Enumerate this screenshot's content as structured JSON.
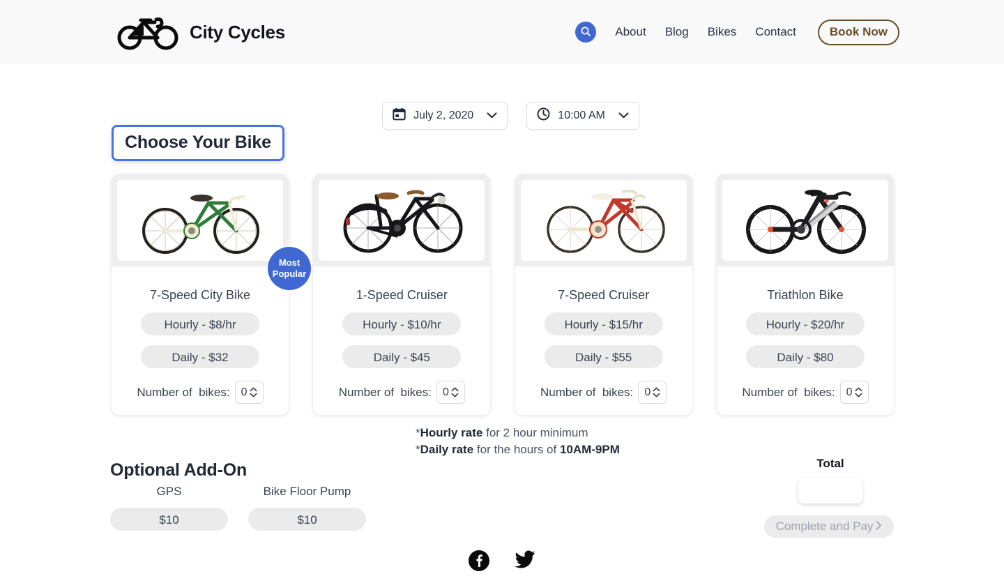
{
  "header": {
    "brand_name": "City Cycles",
    "logo_icon": "bicycle-icon",
    "search_icon": "search-icon",
    "nav": [
      {
        "label": "About"
      },
      {
        "label": "Blog"
      },
      {
        "label": "Bikes"
      },
      {
        "label": "Contact"
      }
    ],
    "book_now_label": "Book Now",
    "book_now_color": "#6b4f24",
    "accent_color": "#3f68d2"
  },
  "pickers": {
    "date": {
      "icon": "calendar-icon",
      "value": "July 2, 2020",
      "chevron": "chevron-down-icon"
    },
    "time": {
      "icon": "clock-icon",
      "value": "10:00 AM",
      "chevron": "chevron-down-icon"
    }
  },
  "choose": {
    "title": "Choose Your Bike",
    "focus_color": "#4a72e8"
  },
  "bikes": [
    {
      "name": "7-Speed City Bike",
      "hourly": "Hourly - $8/hr",
      "daily": "Daily - $32",
      "qty_label": "Number of  bikes:",
      "qty_value": "0",
      "badge_line1": "Most",
      "badge_line2": "Popular",
      "image_icon": "green-city-bike-image"
    },
    {
      "name": "1-Speed Cruiser",
      "hourly": "Hourly - $10/hr",
      "daily": "Daily - $45",
      "qty_label": "Number of  bikes:",
      "qty_value": "0",
      "image_icon": "black-cruiser-bike-image"
    },
    {
      "name": "7-Speed Cruiser",
      "hourly": "Hourly - $15/hr",
      "daily": "Daily - $55",
      "qty_label": "Number of  bikes:",
      "qty_value": "0",
      "image_icon": "red-cruiser-bike-image"
    },
    {
      "name": "Triathlon Bike",
      "hourly": "Hourly - $20/hr",
      "daily": "Daily - $80",
      "qty_label": "Number of  bikes:",
      "qty_value": "0",
      "image_icon": "black-triathlon-bike-image"
    }
  ],
  "notes": {
    "line1_prefix": "*",
    "line1_bold": "Hourly rate",
    "line1_rest": " for 2 hour minimum",
    "line2_prefix": "*",
    "line2_bold": "Daily rate",
    "line2_mid": " for the hours of ",
    "line2_bold2": "10AM-9PM"
  },
  "addons": {
    "title": "Optional Add-On",
    "items": [
      {
        "name": "GPS",
        "price": "$10"
      },
      {
        "name": "Bike Floor Pump",
        "price": "$10"
      }
    ]
  },
  "total": {
    "label": "Total",
    "value": "",
    "pay_label": "Complete and Pay",
    "pay_chevron": "chevron-right-icon"
  },
  "social": [
    {
      "icon": "facebook-icon"
    },
    {
      "icon": "twitter-icon"
    }
  ]
}
